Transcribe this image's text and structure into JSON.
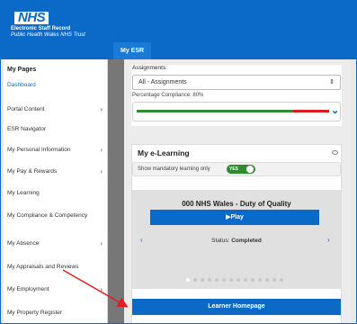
{
  "header": {
    "logo_text": "NHS",
    "org_name": "Electronic Staff Record",
    "org_sub": "Public Health Wales NHS Trust",
    "tab_label": "My ESR",
    "brand_color": "#0b69c7"
  },
  "sidebar": {
    "title": "My Pages",
    "items": [
      {
        "label": "Dashboard",
        "active": true,
        "chevron": false
      },
      {
        "label": "Portal Content",
        "active": false,
        "chevron": true
      },
      {
        "label": "ESR Navigator",
        "active": false,
        "chevron": false
      },
      {
        "label": "My Personal Information",
        "active": false,
        "chevron": true
      },
      {
        "label": "My Pay & Rewards",
        "active": false,
        "chevron": true
      },
      {
        "label": "My Learning",
        "active": false,
        "chevron": false
      },
      {
        "label": "My Compliance & Competency",
        "active": false,
        "chevron": false
      },
      {
        "label": "My Absence",
        "active": false,
        "chevron": true
      },
      {
        "label": "My Appraisals and Reviews",
        "active": false,
        "chevron": false
      },
      {
        "label": "My Employment",
        "active": false,
        "chevron": true
      },
      {
        "label": "My Property Register",
        "active": false,
        "chevron": false
      }
    ],
    "chevron_glyph": "›"
  },
  "assignments": {
    "label": "Assignments:",
    "selected": "All - Assignments",
    "select_arrows": "⇕",
    "compliance_text": "Percentage Compliance: 80%",
    "compliance_value": 0.8,
    "expand_glyph": "⌄"
  },
  "elearning": {
    "title": "My e-Learning",
    "toggle_label": "Show mandatory learning only",
    "toggle_state": "YES",
    "course_title": "000 NHS Wales - Duty of Quality",
    "play_label": "▶Play",
    "status_prefix": "Status: ",
    "status_value": "Completed",
    "prev_glyph": "‹",
    "next_glyph": "›",
    "dot_count": 14,
    "active_dot": 0,
    "learner_button": "Learner Homepage"
  },
  "annotation_color": "#e02020"
}
